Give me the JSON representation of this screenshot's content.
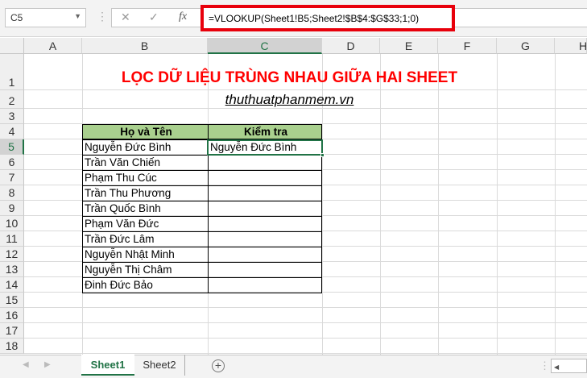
{
  "name_box": "C5",
  "formula": "=VLOOKUP(Sheet1!B5;Sheet2!$B$4:$G$33;1;0)",
  "fx_label": "fx",
  "columns": [
    "A",
    "B",
    "C",
    "D",
    "E",
    "F",
    "G",
    "H"
  ],
  "rows": [
    "1",
    "2",
    "3",
    "4",
    "5",
    "6",
    "7",
    "8",
    "9",
    "10",
    "11",
    "12",
    "13",
    "14",
    "15",
    "16",
    "17",
    "18"
  ],
  "title": "LỌC DỮ LIỆU TRÙNG NHAU GIỮA HAI SHEET",
  "site": "thuthuatphanmem.vn",
  "table": {
    "headers": [
      "Họ và Tên",
      "Kiểm tra"
    ],
    "names": [
      "Nguyễn Đức Bình",
      "Trần Văn Chiến",
      "Phạm Thu Cúc",
      "Trần Thu Phương",
      "Trần Quốc Bình",
      "Phạm Văn Đức",
      "Trần Đức Lâm",
      "Nguyễn Nhật Minh",
      "Nguyễn Thị Châm",
      "Đinh Đức Bảo"
    ],
    "check": [
      "Nguyễn Đức Bình",
      "",
      "",
      "",
      "",
      "",
      "",
      "",
      "",
      ""
    ]
  },
  "sheets": [
    "Sheet1",
    "Sheet2"
  ],
  "active_sheet": "Sheet1",
  "colors": {
    "title": "#ff0000",
    "header_fill": "#a9d08e",
    "excel_green": "#217346",
    "highlight": "#e8000b"
  }
}
